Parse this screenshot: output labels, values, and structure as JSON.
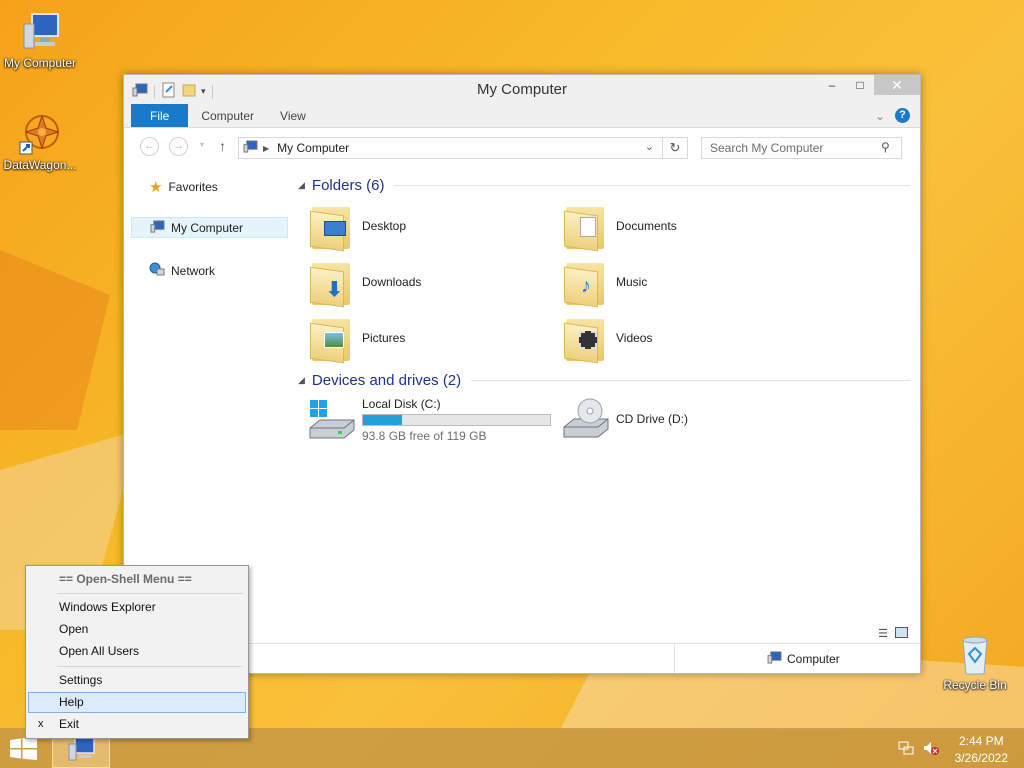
{
  "desktop": {
    "icons": [
      {
        "label": "My Computer",
        "icon": "computer-icon"
      },
      {
        "label": "DataWagon...",
        "icon": "datawagon-shortcut-icon"
      },
      {
        "label": "Recycle Bin",
        "icon": "recycle-bin-icon"
      }
    ]
  },
  "window": {
    "title": "My Computer",
    "controls": {
      "minimize": "–",
      "maximize": "□",
      "close": "✕"
    },
    "ribbon": {
      "tabs": [
        {
          "label": "File",
          "active": true
        },
        {
          "label": "Computer"
        },
        {
          "label": "View"
        }
      ]
    },
    "address": {
      "path": "My Computer",
      "search_placeholder": "Search My Computer"
    },
    "nav_pane": {
      "items": [
        {
          "label": "Favorites",
          "icon": "star-icon"
        },
        {
          "label": "My Computer",
          "icon": "computer-icon",
          "selected": true
        },
        {
          "label": "Network",
          "icon": "network-icon"
        }
      ]
    },
    "folders": {
      "header": "Folders (6)",
      "items": [
        {
          "label": "Desktop",
          "icon": "desktop-folder-icon"
        },
        {
          "label": "Documents",
          "icon": "documents-folder-icon"
        },
        {
          "label": "Downloads",
          "icon": "downloads-folder-icon"
        },
        {
          "label": "Music",
          "icon": "music-folder-icon"
        },
        {
          "label": "Pictures",
          "icon": "pictures-folder-icon"
        },
        {
          "label": "Videos",
          "icon": "videos-folder-icon"
        }
      ]
    },
    "drives": {
      "header": "Devices and drives (2)",
      "items": [
        {
          "label": "Local Disk (C:)",
          "free_text": "93.8 GB free of 119 GB",
          "used_fraction": 0.21,
          "icon": "hard-disk-icon"
        },
        {
          "label": "CD Drive (D:)",
          "icon": "cd-drive-icon"
        }
      ]
    },
    "status": {
      "location": "Computer"
    }
  },
  "start_menu": {
    "header": "== Open-Shell Menu ==",
    "items": [
      {
        "label": "Windows Explorer"
      },
      {
        "label": "Open"
      },
      {
        "label": "Open All Users"
      },
      {
        "label": "Settings"
      },
      {
        "label": "Help",
        "highlighted": true
      },
      {
        "label": "Exit",
        "mark": "x"
      }
    ]
  },
  "taskbar": {
    "time": "2:44 PM",
    "date": "3/26/2022"
  },
  "colors": {
    "accent": "#1979ca",
    "progress": "#26a0da",
    "taskbar": "#c49644"
  }
}
